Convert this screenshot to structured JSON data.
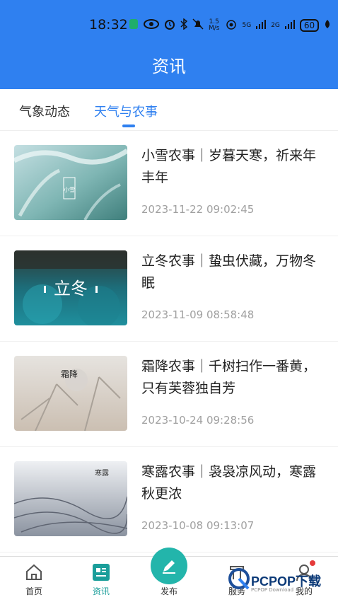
{
  "status_bar": {
    "time": "18:32",
    "speed_value": "1.5",
    "speed_unit": "M/s",
    "net1": "5G",
    "net2": "2G",
    "battery": "60"
  },
  "header": {
    "title": "资讯"
  },
  "tabs": [
    {
      "label": "气象动态",
      "active": false
    },
    {
      "label": "天气与农事",
      "active": true
    }
  ],
  "articles": [
    {
      "title": "小雪农事｜岁暮天寒，祈来年丰年",
      "date": "2023-11-22 09:02:45",
      "thumb_text": "小雪"
    },
    {
      "title": "立冬农事｜蛰虫伏藏，万物冬眠",
      "date": "2023-11-09 08:58:48",
      "thumb_text": "立冬"
    },
    {
      "title": "霜降农事｜千树扫作一番黄，只有芙蓉独自芳",
      "date": "2023-10-24 09:28:56",
      "thumb_text": "霜降"
    },
    {
      "title": "寒露农事｜袅袅凉风动，寒露秋更浓",
      "date": "2023-10-08 09:13:07",
      "thumb_text": "寒露"
    }
  ],
  "bottom_nav": [
    {
      "label": "首页",
      "icon": "home-icon",
      "active": false
    },
    {
      "label": "资讯",
      "icon": "news-icon",
      "active": true
    },
    {
      "label": "发布",
      "icon": "pencil-icon",
      "active": false
    },
    {
      "label": "服务",
      "icon": "service-icon",
      "active": false
    },
    {
      "label": "我的",
      "icon": "user-icon",
      "active": false
    }
  ],
  "watermark": {
    "text": "PCPOP下载",
    "sub": "PCPOP Download"
  },
  "colors": {
    "primary": "#2f80f0",
    "teal": "#23b5ab",
    "notification": "#e53b3b"
  }
}
